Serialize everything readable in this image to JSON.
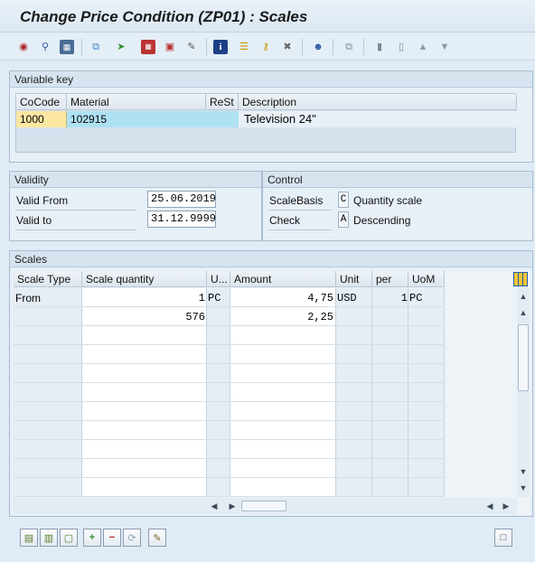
{
  "window": {
    "title": "Change Price Condition (ZP01) : Scales"
  },
  "toolbar": {
    "icons": [
      "customer-icon",
      "find-icon",
      "detail-icon",
      "copy-icon",
      "forward-icon",
      "calculator-icon",
      "gift-icon",
      "edit-icon",
      "info-icon",
      "hierarchy-icon",
      "keys-icon",
      "tools-icon",
      "person-icon",
      "copy-doc-icon",
      "page-first-icon",
      "page-prev-icon",
      "up-arrow-icon",
      "down-arrow-icon"
    ]
  },
  "variable_key": {
    "title": "Variable key",
    "columns": [
      "CoCode",
      "Material",
      "ReSt",
      "Description"
    ],
    "row": {
      "cocode": "1000",
      "material": "102915",
      "rest": "",
      "description": "Television 24\""
    }
  },
  "validity": {
    "title": "Validity",
    "valid_from_label": "Valid From",
    "valid_from": "25.06.2019",
    "valid_to_label": "Valid to",
    "valid_to": "31.12.9999"
  },
  "control": {
    "title": "Control",
    "scale_basis_label": "ScaleBasis",
    "scale_basis_key": "C",
    "scale_basis_text": "Quantity scale",
    "check_label": "Check",
    "check_key": "A",
    "check_text": "Descending"
  },
  "scales": {
    "title": "Scales",
    "columns": [
      "Scale Type",
      "Scale quantity",
      "U...",
      "Amount",
      "Unit",
      "per",
      "UoM"
    ],
    "rows": [
      {
        "type": "From",
        "qty": "1",
        "u": "PC",
        "amount": "4,75",
        "unit": "USD",
        "per": "1",
        "uom": "PC"
      },
      {
        "type": "",
        "qty": "576",
        "u": "",
        "amount": "2,25",
        "unit": "",
        "per": "",
        "uom": ""
      }
    ]
  },
  "colors": {
    "key_cell": "#fbe6a2",
    "material_cell": "#aee2f2",
    "header_bg": "#dfebf5"
  }
}
